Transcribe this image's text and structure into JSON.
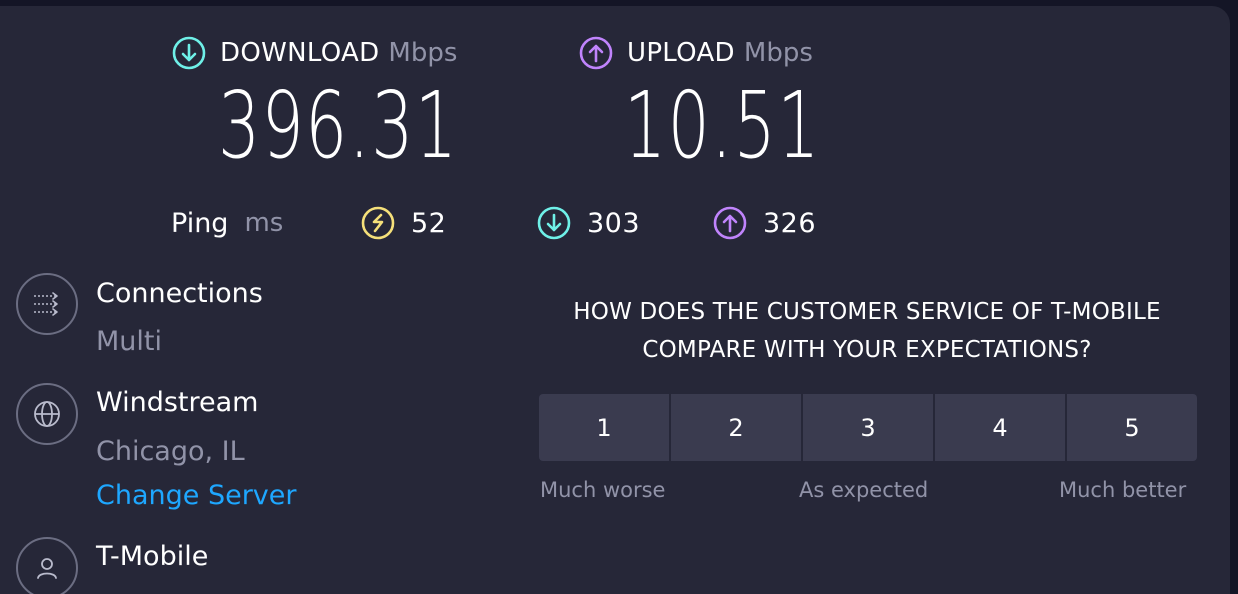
{
  "download": {
    "label": "DOWNLOAD",
    "unit": "Mbps",
    "value": "396.31",
    "icon": "arrow-down-circle-icon",
    "color": "#6ff0e8"
  },
  "upload": {
    "label": "UPLOAD",
    "unit": "Mbps",
    "value": "10.51",
    "icon": "arrow-up-circle-icon",
    "color": "#c084fc"
  },
  "ping": {
    "label": "Ping",
    "unit": "ms",
    "idle": "52",
    "download": "303",
    "upload": "326",
    "idle_color": "#f5e07a"
  },
  "connections": {
    "title": "Connections",
    "value": "Multi",
    "icon": "connections-icon"
  },
  "server": {
    "name": "Windstream",
    "location": "Chicago, IL",
    "change_label": "Change Server",
    "icon": "globe-icon"
  },
  "provider": {
    "name": "T-Mobile",
    "icon": "user-icon"
  },
  "survey": {
    "question_line1": "HOW DOES THE CUSTOMER SERVICE OF T-MOBILE",
    "question_line2": "COMPARE WITH YOUR EXPECTATIONS?",
    "options": [
      "1",
      "2",
      "3",
      "4",
      "5"
    ],
    "low_label": "Much worse",
    "mid_label": "As expected",
    "high_label": "Much better"
  }
}
